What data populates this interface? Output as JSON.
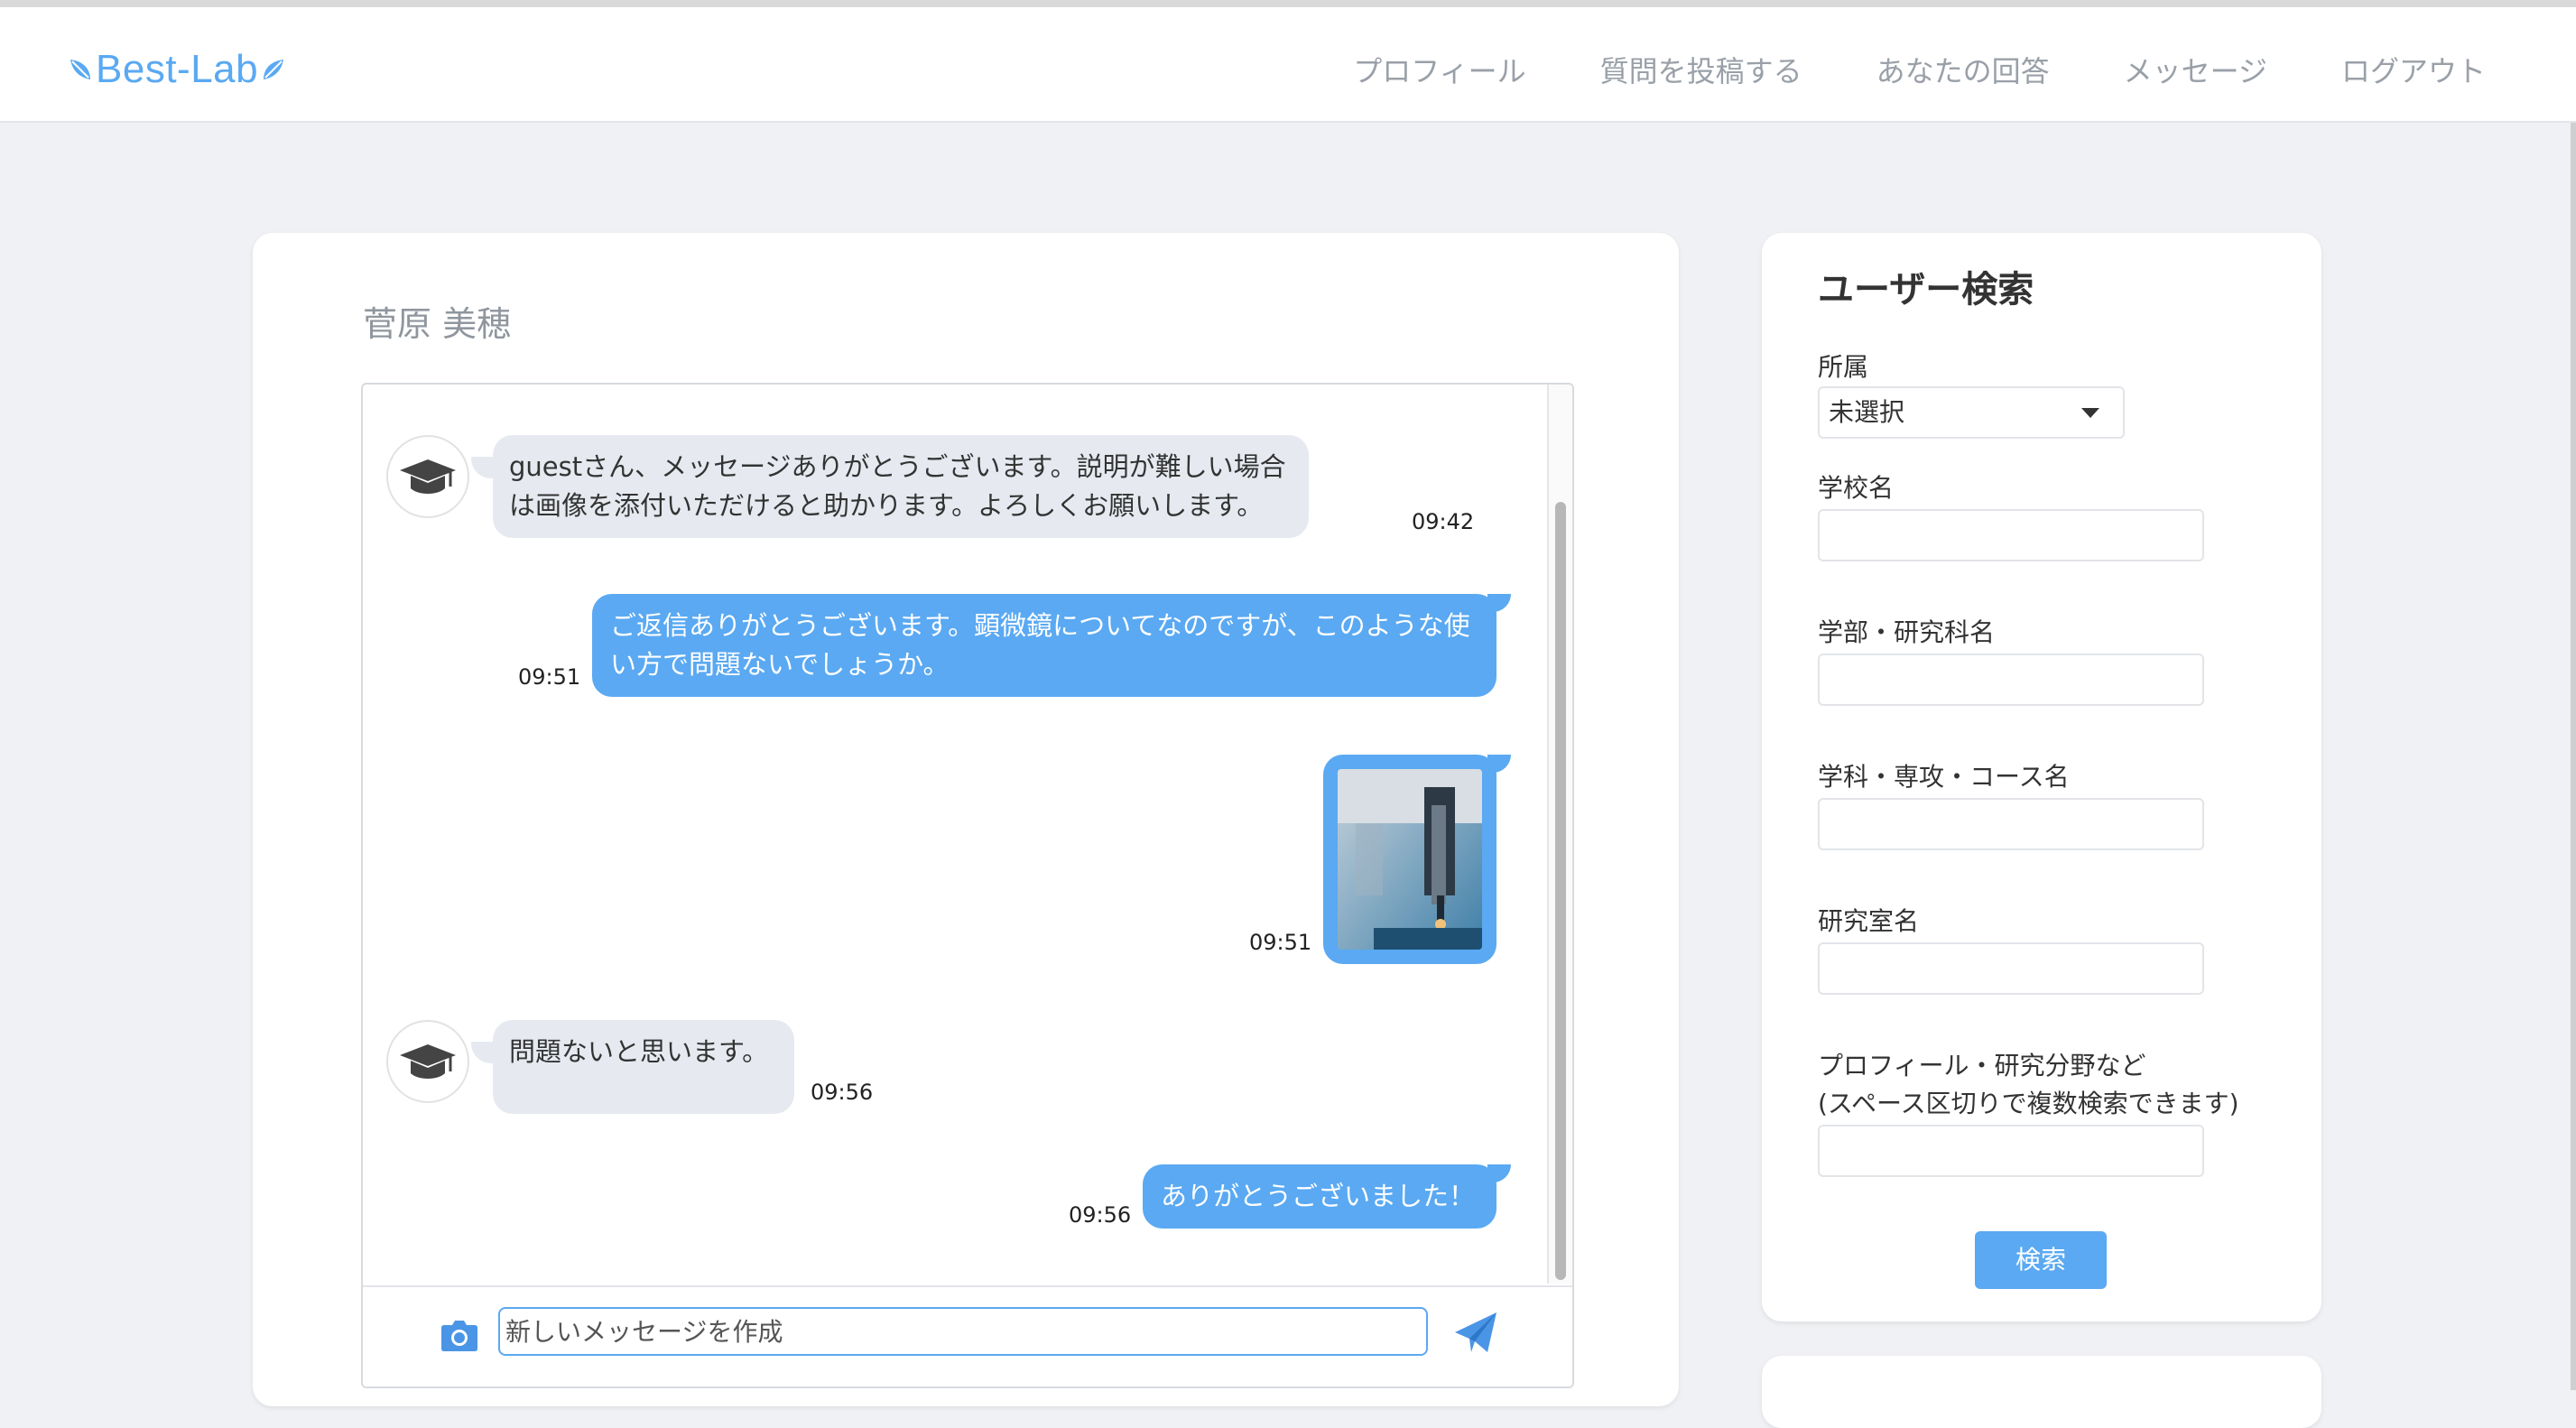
{
  "header": {
    "logo": "Best-Lab",
    "nav": [
      "プロフィール",
      "質問を投稿する",
      "あなたの回答",
      "メッセージ",
      "ログアウト"
    ]
  },
  "chat": {
    "partner_name": "菅原 美穂",
    "messages": [
      {
        "direction": "in",
        "text": "guestさん、メッセージありがとうございます。説明が難しい場合は画像を添付いただけると助かります。よろしくお願いします。",
        "time": "09:42"
      },
      {
        "direction": "out",
        "text": "ご返信ありがとうございます。顕微鏡についてなのですが、このような使い方で問題ないでしょうか。",
        "time": "09:51"
      },
      {
        "direction": "out",
        "type": "image",
        "time": "09:51"
      },
      {
        "direction": "in",
        "text": "問題ないと思います。",
        "time": "09:56"
      },
      {
        "direction": "out",
        "text": "ありがとうございました！",
        "time": "09:56"
      }
    ],
    "composer": {
      "placeholder": "新しいメッセージを作成",
      "camera_icon": "camera-icon",
      "send_icon": "send-icon"
    }
  },
  "search": {
    "title": "ユーザー検索",
    "affiliation_label": "所属",
    "affiliation_value": "未選択",
    "school_label": "学校名",
    "faculty_label": "学部・研究科名",
    "department_label": "学科・専攻・コース名",
    "lab_label": "研究室名",
    "profile_label_1": "プロフィール・研究分野など",
    "profile_label_2": "(スペース区切りで複数検索できます)",
    "button": "検索"
  },
  "colors": {
    "accent": "#5aa9f2",
    "incoming_bubble": "#e6eaf0",
    "background": "#f0f1f4"
  }
}
